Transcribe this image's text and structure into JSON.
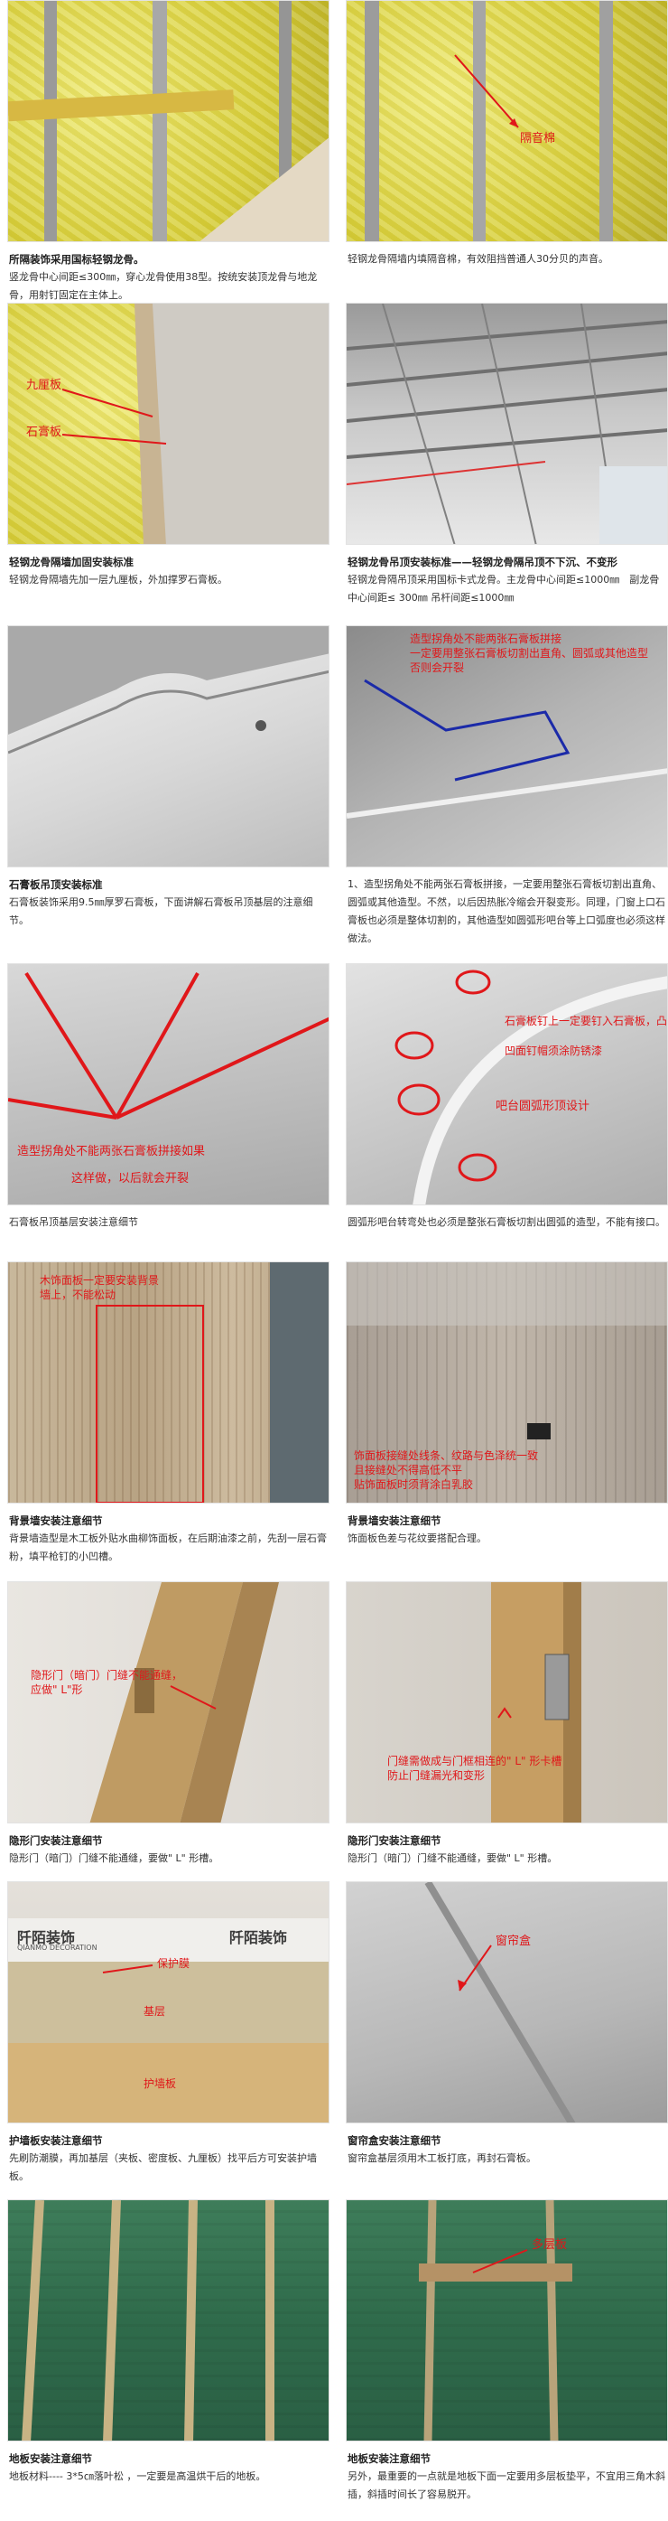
{
  "items": [
    {
      "title": "所隔装饰采用国标轻钢龙骨。",
      "body": "竖龙骨中心间距≤300㎜，穿心龙骨使用38型。按统安装顶龙骨与地龙骨，用射钉固定在主体上。",
      "labels": []
    },
    {
      "title": "",
      "body": "轻钢龙骨隔墙内填隔音棉，有效阻挡普通人30分贝的声音。",
      "labels": [
        "隔音棉"
      ]
    },
    {
      "title": "轻钢龙骨隔墙加固安装标准",
      "body": "轻钢龙骨隔墙先加一层九厘板，外加撑罗石膏板。",
      "labels": [
        "九厘板",
        "石膏板"
      ]
    },
    {
      "title": "轻钢龙骨吊顶安装标准——轻钢龙骨隔吊顶不下沉、不变形",
      "body": "轻钢龙骨隔吊顶采用国标卡式龙骨。主龙骨中心间距≤1000㎜　副龙骨中心间距≤ 300㎜ 吊杆间距≤1000㎜",
      "labels": []
    },
    {
      "title": "石膏板吊顶安装标准",
      "body": "石膏板装饰采用9.5㎜厚罗石膏板，下面讲解石膏板吊顶基层的注意细节。",
      "labels": []
    },
    {
      "title": "",
      "body": "1、造型拐角处不能两张石膏板拼接，一定要用整张石膏板切割出直角、圆弧或其他造型。不然，以后因热胀冷缩会开裂变形。同理，门窗上口石膏板也必须是整体切割的，其他造型如圆弧形吧台等上口弧度也必须这样做法。",
      "labels": [
        "造型拐角处不能两张石膏板拼接",
        "一定要用整张石膏板切割出直角、圆弧或其他造型",
        "否则会开裂"
      ]
    },
    {
      "title": "",
      "body": "石膏板吊顶基层安装注意细节",
      "labels": [
        "造型拐角处不能两张石膏板拼接如果",
        "这样做，以后就会开裂"
      ]
    },
    {
      "title": "",
      "body": "圆弧形吧台转弯处也必须是整张石膏板切割出圆弧的造型，不能有接口。",
      "labels": [
        "石膏板钉上一定要钉入石膏板，凸出层面不平整",
        "凹面钉帽须涂防锈漆",
        "吧台圆弧形顶设计"
      ]
    },
    {
      "title": "背景墙安装注意细节",
      "body": "背景墙造型是木工板外贴水曲柳饰面板，在后期油漆之前，先刮一层石膏粉，填平枪钉的小凹槽。",
      "labels": [
        "木饰面板一定要安装背景",
        "墙上，不能松动"
      ]
    },
    {
      "title": "背景墙安装注意细节",
      "body": "饰面板色差与花纹要搭配合理。",
      "labels": [
        "饰面板接缝处线条、纹路与色泽统一致",
        "且接缝处不得高低不平",
        "贴饰面板时须背涂白乳胶"
      ]
    },
    {
      "title": "隐形门安装注意细节",
      "body": "隐形门（暗门）门缝不能通缝，要做\" L\" 形槽。",
      "labels": [
        "隐形门（暗门）门缝不能通缝，",
        "应做\" L\"形"
      ]
    },
    {
      "title": "隐形门安装注意细节",
      "body": "隐形门（暗门）门缝不能通缝，要做\" L\" 形槽。",
      "labels": [
        "门缝需做成与门框相连的\" L\" 形卡槽",
        "防止门缝漏光和变形"
      ]
    },
    {
      "title": "护墙板安装注意细节",
      "body": "先刷防潮膜，再加基层（夹板、密度板、九厘板）找平后方可安装护墙板。",
      "labels": [
        "保护膜",
        "基层",
        "护墙板"
      ],
      "brand": "阡陌装饰",
      "brand_en": "QIANMO DECORATION"
    },
    {
      "title": "窗帘盒安装注意细节",
      "body": "窗帘盒基层须用木工板打底，再封石膏板。",
      "labels": [
        "窗帘盒"
      ]
    },
    {
      "title": "地板安装注意细节",
      "body": "地板材料---- 3*5㎝落叶松 ，一定要是高温烘干后的地板。",
      "labels": []
    },
    {
      "title": "地板安装注意细节",
      "body": "另外，最重要的一点就是地板下面一定要用多层板垫平，不宜用三角木斜插，斜插时间长了容易脱开。",
      "labels": [
        "多层板"
      ]
    }
  ]
}
